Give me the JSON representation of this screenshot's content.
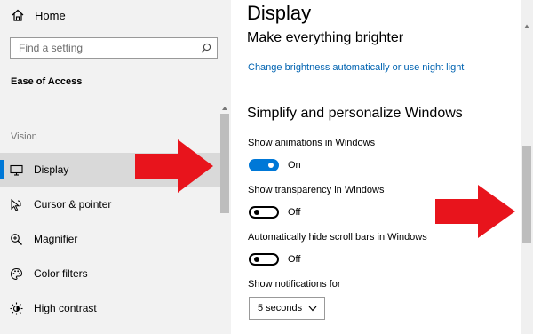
{
  "sidebar": {
    "home_label": "Home",
    "search_placeholder": "Find a setting",
    "section_heading": "Ease of Access",
    "group_label": "Vision",
    "items": [
      {
        "label": "Display",
        "icon": "monitor-icon",
        "selected": true
      },
      {
        "label": "Cursor & pointer",
        "icon": "cursor-icon",
        "selected": false
      },
      {
        "label": "Magnifier",
        "icon": "magnifier-icon",
        "selected": false
      },
      {
        "label": "Color filters",
        "icon": "color-filters-icon",
        "selected": false
      },
      {
        "label": "High contrast",
        "icon": "high-contrast-icon",
        "selected": false
      }
    ]
  },
  "main": {
    "title": "Display",
    "subtitle": "Make everything brighter",
    "brightness_link": "Change brightness automatically or use night light",
    "section_title": "Simplify and personalize Windows",
    "settings": [
      {
        "label": "Show animations in Windows",
        "state": "On"
      },
      {
        "label": "Show transparency in Windows",
        "state": "Off"
      },
      {
        "label": "Automatically hide scroll bars in Windows",
        "state": "Off"
      }
    ],
    "notifications": {
      "label": "Show notifications for",
      "selected": "5 seconds"
    }
  },
  "colors": {
    "accent": "#0078d7",
    "link": "#0063b1",
    "sidebar_bg": "#f2f2f2",
    "selected_bg": "#d9d9d9",
    "annotation_arrow": "#e8141c"
  }
}
